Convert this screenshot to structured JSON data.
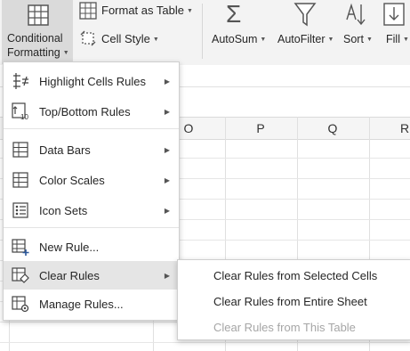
{
  "ribbon": {
    "conditional_formatting": {
      "line1": "Conditional",
      "line2": "Formatting"
    },
    "format_as_table": "Format as Table",
    "cell_style": "Cell Style",
    "autosum": "AutoSum",
    "autofilter": "AutoFilter",
    "sort": "Sort",
    "fill": "Fill"
  },
  "columns": [
    "O",
    "P",
    "Q",
    "R"
  ],
  "menu": {
    "items": [
      {
        "label": "Highlight Cells Rules",
        "icon": "highlight-cells-icon",
        "submenu": true
      },
      {
        "label": "Top/Bottom Rules",
        "icon": "top-bottom-icon",
        "submenu": true
      },
      {
        "label": "Data Bars",
        "icon": "data-bars-icon",
        "submenu": true
      },
      {
        "label": "Color Scales",
        "icon": "color-scales-icon",
        "submenu": true
      },
      {
        "label": "Icon Sets",
        "icon": "icon-sets-icon",
        "submenu": true
      },
      {
        "label": "New Rule...",
        "icon": "new-rule-icon",
        "submenu": false
      },
      {
        "label": "Clear Rules",
        "icon": "clear-rules-icon",
        "submenu": true,
        "selected": true
      },
      {
        "label": "Manage Rules...",
        "icon": "manage-rules-icon",
        "submenu": false
      }
    ]
  },
  "submenu": {
    "items": [
      {
        "label": "Clear Rules from Selected Cells",
        "enabled": true
      },
      {
        "label": "Clear Rules from Entire Sheet",
        "enabled": true
      },
      {
        "label": "Clear Rules from This Table",
        "enabled": false
      }
    ]
  },
  "colors": {
    "ribbon_bg": "#f3f3f3",
    "selected_bg": "#e5e5e5",
    "disabled_text": "#a6a6a6",
    "icon_blue": "#2b579a"
  }
}
